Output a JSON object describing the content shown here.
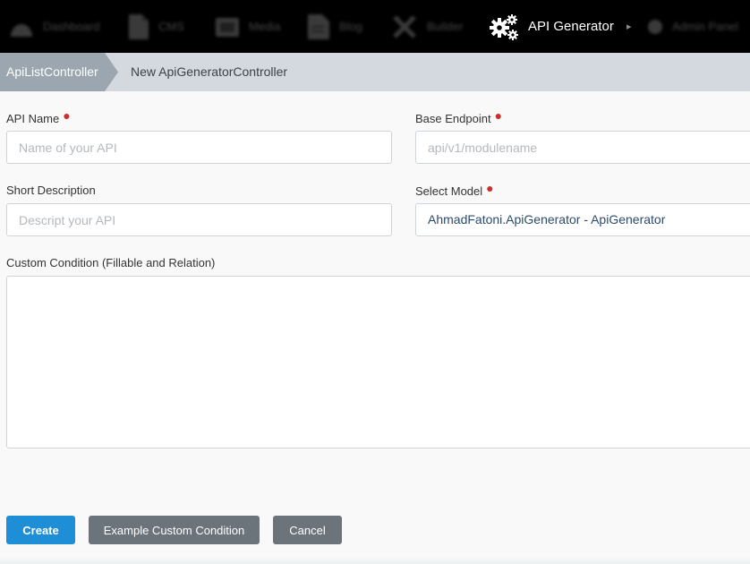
{
  "nav": {
    "items": [
      {
        "label": "Dashboard",
        "icon": "dashboard-icon"
      },
      {
        "label": "CMS",
        "icon": "cms-icon"
      },
      {
        "label": "Media",
        "icon": "media-icon"
      },
      {
        "label": "Blog",
        "icon": "blog-icon"
      },
      {
        "label": "Builder",
        "icon": "builder-icon"
      },
      {
        "label": "API Generator",
        "icon": "gears-icon",
        "active": true
      },
      {
        "label": "Admin Panel",
        "icon": "admin-icon"
      }
    ]
  },
  "breadcrumb": {
    "parent": "ApiListController",
    "current": "New ApiGeneratorController"
  },
  "form": {
    "api_name": {
      "label": "API Name",
      "required": true,
      "value": "",
      "placeholder": "Name of your API"
    },
    "base_endpoint": {
      "label": "Base Endpoint",
      "required": true,
      "value": "",
      "placeholder": "api/v1/modulename"
    },
    "short_description": {
      "label": "Short Description",
      "required": false,
      "value": "",
      "placeholder": "Descript your API"
    },
    "select_model": {
      "label": "Select Model",
      "required": true,
      "value": "AhmadFatoni.ApiGenerator - ApiGenerator"
    },
    "custom_condition": {
      "label": "Custom Condition (Fillable and Relation)",
      "value": ""
    }
  },
  "actions": {
    "create": "Create",
    "example": "Example Custom Condition",
    "cancel": "Cancel"
  },
  "colors": {
    "nav_bg": "#000000",
    "breadcrumb_bg": "#d3d9de",
    "breadcrumb_parent_bg": "#9ba6b0",
    "primary": "#1e8fd6",
    "secondary": "#6b737b",
    "required": "#c9302c"
  }
}
